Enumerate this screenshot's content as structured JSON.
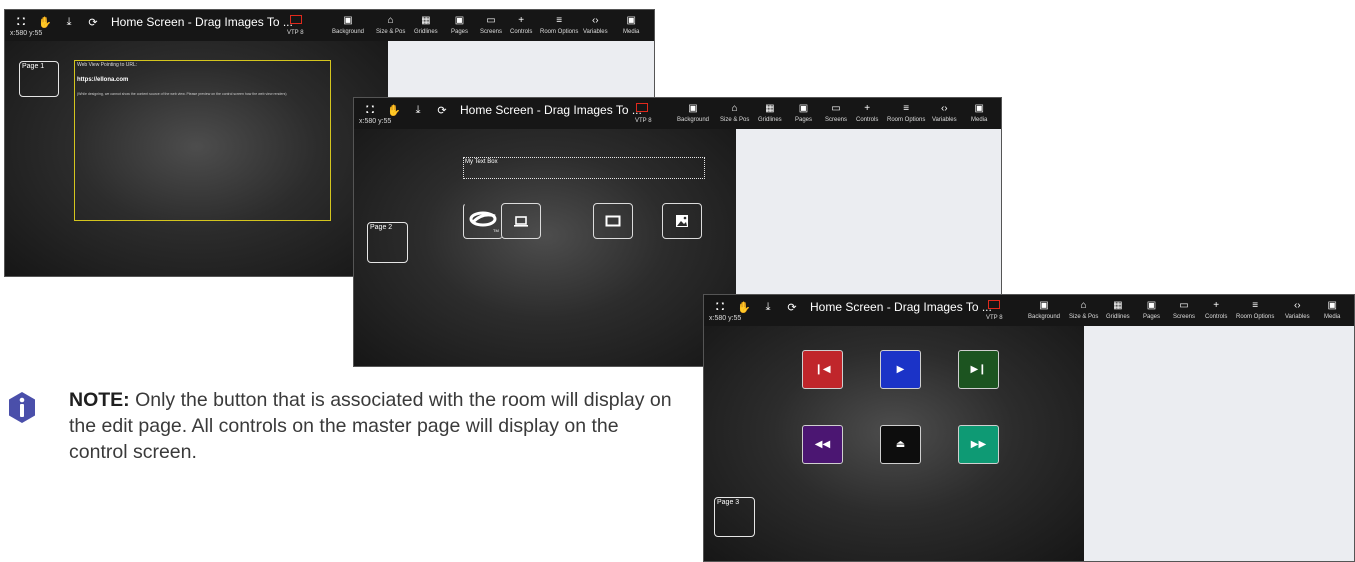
{
  "toolbar": {
    "title": "Home Screen - Drag Images To ...",
    "coords": "x:580 y:55",
    "vtp_label": "VTP 8",
    "left_icons": [
      "shield-icon",
      "hand-icon",
      "download-icon",
      "refresh-icon"
    ],
    "buttons": [
      {
        "label": "Background",
        "icon": "image-icon"
      },
      {
        "label": "Size & Pos",
        "icon": "lock-icon"
      },
      {
        "label": "Gridlines",
        "icon": "grid-icon"
      },
      {
        "label": "Pages",
        "icon": "pages-icon"
      },
      {
        "label": "Screens",
        "icon": "screens-icon"
      },
      {
        "label": "Controls",
        "icon": "plus-icon"
      },
      {
        "label": "Room Options",
        "icon": "sliders-icon"
      },
      {
        "label": "Variables",
        "icon": "code-icon"
      },
      {
        "label": "Media",
        "icon": "media-icon"
      }
    ]
  },
  "screen1": {
    "page_label": "Page 1",
    "webview": {
      "heading": "Web View Pointing to URL:",
      "url": "https://ellona.com",
      "note": "(While designing, we cannot show the content source of the web view. Please preview on the control screen how the web view renders)"
    }
  },
  "screen2": {
    "page_label": "Page 2",
    "textbox_label": "My Text Box",
    "devices": [
      "bluray-icon",
      "laptop-icon",
      "display-icon",
      "image-icon"
    ]
  },
  "screen3": {
    "page_label": "Page 3",
    "media_buttons": [
      {
        "name": "previous-track-button",
        "icon": "skip-back-icon",
        "color": "#c0262b"
      },
      {
        "name": "play-button",
        "icon": "play-icon",
        "color": "#1b33c7"
      },
      {
        "name": "next-track-button",
        "icon": "skip-forward-icon",
        "color": "#1c5420"
      },
      {
        "name": "rewind-button",
        "icon": "rewind-icon",
        "color": "#4b1672"
      },
      {
        "name": "eject-button",
        "icon": "eject-icon",
        "color": "#0d0d0d"
      },
      {
        "name": "fast-forward-button",
        "icon": "fast-forward-icon",
        "color": "#0e9a74"
      }
    ]
  },
  "note": {
    "bold": "NOTE:",
    "text": " Only the button that is associated with the room will display on the edit page. All controls on the master page will display on the control screen.",
    "icon": "info-icon",
    "icon_color": "#4a4faa"
  }
}
